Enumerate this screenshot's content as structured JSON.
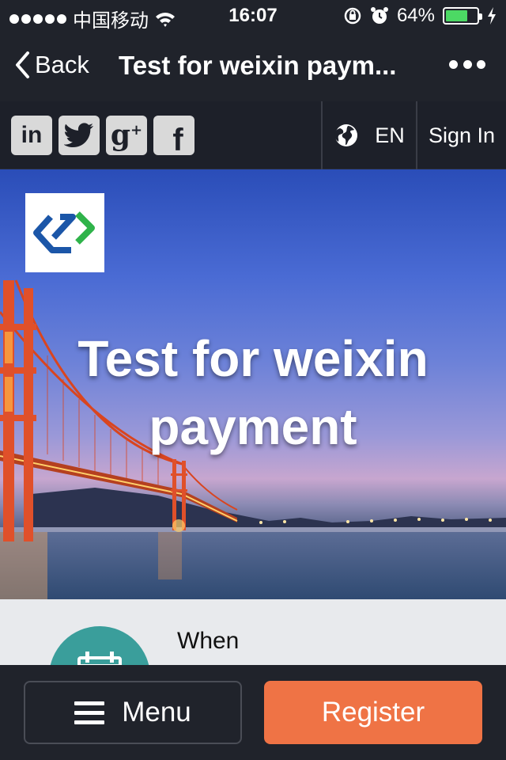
{
  "status_bar": {
    "carrier": "中国移动",
    "time": "16:07",
    "battery_percent_label": "64%",
    "battery_level": 0.64
  },
  "nav": {
    "back_label": "Back",
    "title": "Test for weixin paym..."
  },
  "site_bar": {
    "social": [
      {
        "icon": "linkedin-icon",
        "label": "in"
      },
      {
        "icon": "twitter-icon",
        "label": ""
      },
      {
        "icon": "google-plus-icon",
        "label": "g+"
      },
      {
        "icon": "facebook-icon",
        "label": "f"
      }
    ],
    "language": "EN",
    "sign_in": "Sign In"
  },
  "hero": {
    "title": "Test for weixin payment",
    "logo": "event-logo"
  },
  "content": {
    "partial_text": "When"
  },
  "bottom_bar": {
    "menu_label": "Menu",
    "register_label": "Register"
  },
  "colors": {
    "background": "#20232b",
    "register_accent": "#ef7345",
    "battery_fill": "#4cd964",
    "logo_blue": "#1b56a8",
    "logo_green": "#2fb34a",
    "circle_teal": "#3a9e9b"
  }
}
